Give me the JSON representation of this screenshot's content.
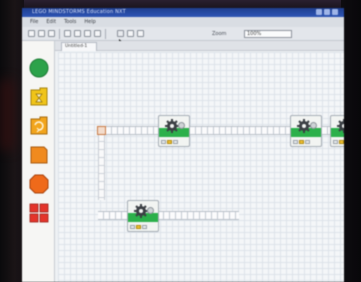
{
  "window": {
    "title": "LEGO MINDSTORMS Education NXT"
  },
  "menubar": {
    "items": [
      "File",
      "Edit",
      "Tools",
      "Help"
    ]
  },
  "toolbar": {
    "zoom_label": "Zoom",
    "zoom_value": "100%"
  },
  "tab": {
    "label": "Untitled-1"
  },
  "palette": {
    "items": [
      {
        "name": "action-block",
        "icon": "green-circle-icon",
        "color": "#2ca24a"
      },
      {
        "name": "wait-block",
        "icon": "hourglass-icon",
        "color": "#f0c419"
      },
      {
        "name": "loop-block",
        "icon": "loop-icon",
        "color": "#f2a51c"
      },
      {
        "name": "switch-block",
        "icon": "switch-icon",
        "color": "#f08a1e"
      },
      {
        "name": "stop-block",
        "icon": "stop-octagon-icon",
        "color": "#ef6a1a"
      },
      {
        "name": "my-blocks",
        "icon": "grid-blocks-icon",
        "color": "#e4342a"
      }
    ]
  },
  "program": {
    "blocks": [
      {
        "name": "motor-block-1",
        "icon": "gear-icon",
        "ports": [
          "A",
          "B",
          "C"
        ],
        "active_port": "B"
      },
      {
        "name": "motor-block-2",
        "icon": "gear-icon",
        "ports": [
          "A",
          "B",
          "C"
        ],
        "active_port": "B"
      },
      {
        "name": "motor-block-3",
        "icon": "gear-icon",
        "ports": [
          "A",
          "B",
          "C"
        ],
        "active_port": "B"
      },
      {
        "name": "motor-block-4",
        "icon": "gear-icon",
        "ports": [
          "A",
          "B",
          "C"
        ],
        "active_port": "B"
      }
    ]
  },
  "colors": {
    "title_bar": "#2e55b6",
    "block_green": "#2bb04a",
    "canvas": "#f4f6f8",
    "start_node": "#c87a44"
  }
}
